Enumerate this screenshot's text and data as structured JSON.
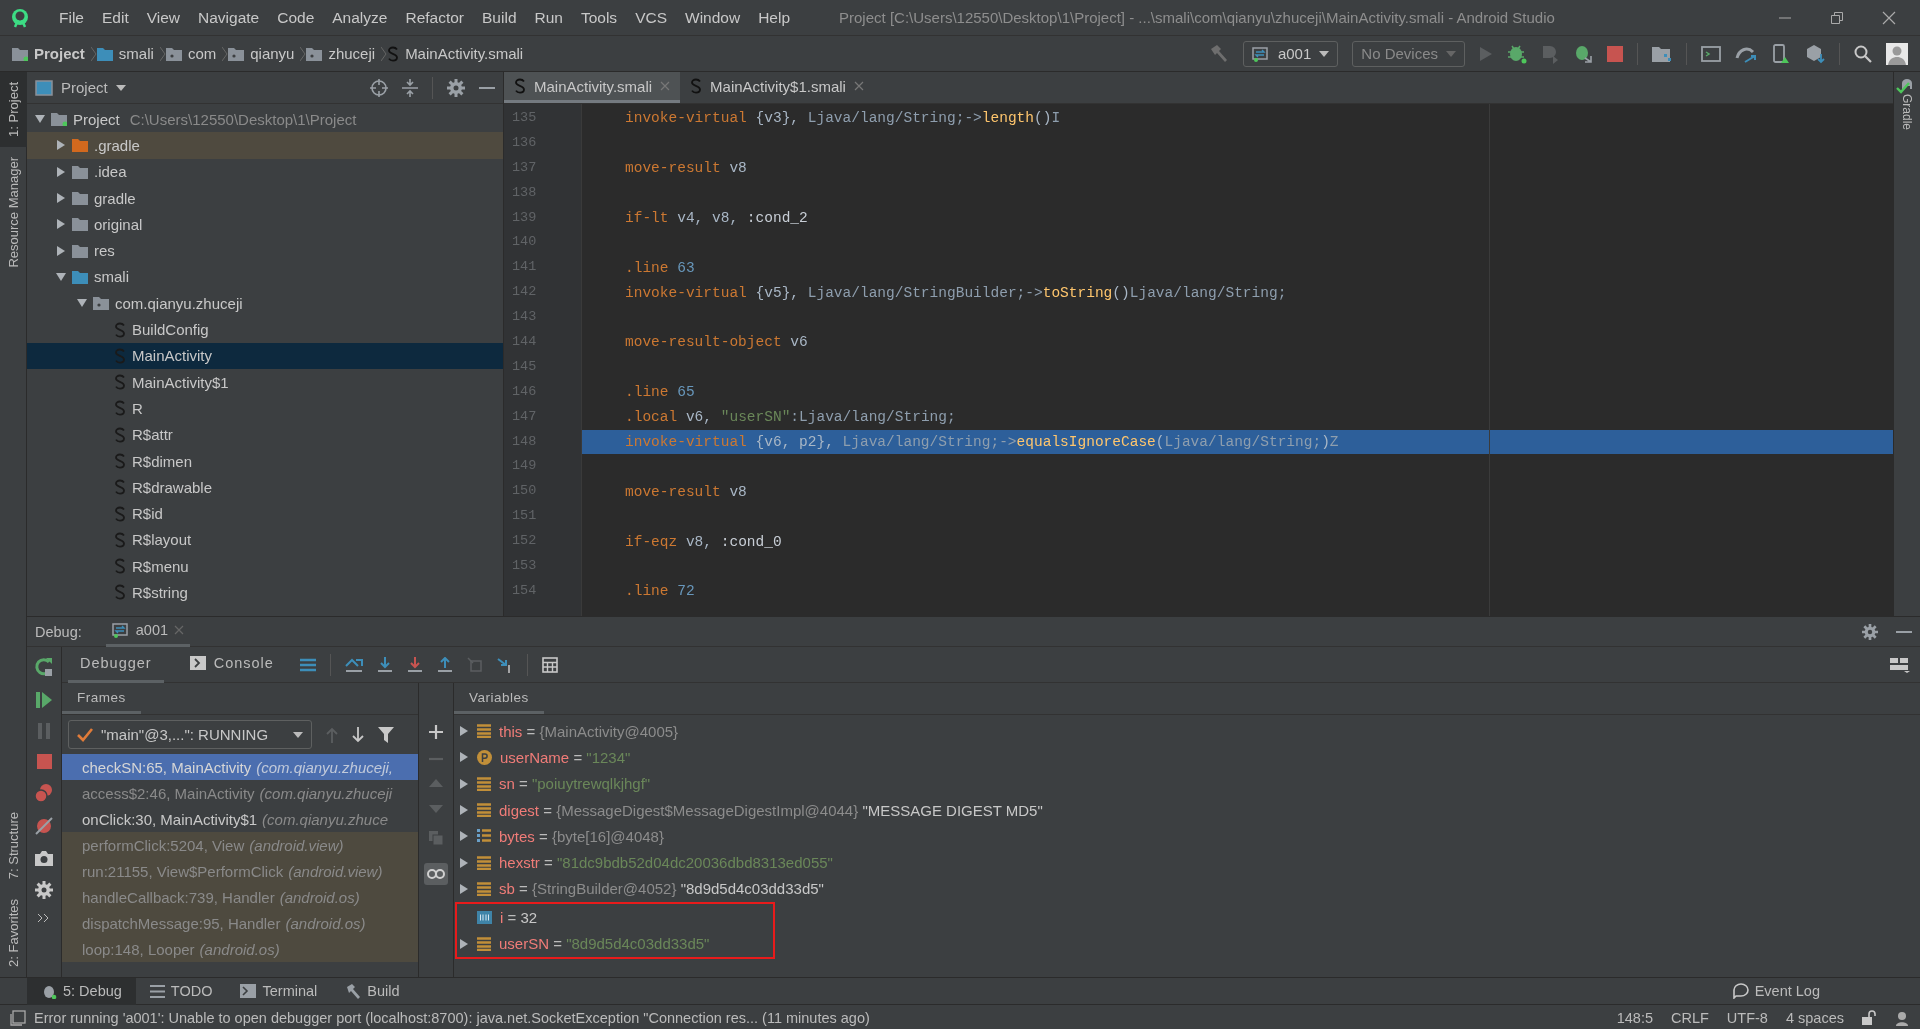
{
  "window": {
    "title": "Project [C:\\Users\\12550\\Desktop\\1\\Project] - ...\\smali\\com\\qianyu\\zhuceji\\MainActivity.smali - Android Studio"
  },
  "menu": [
    "File",
    "Edit",
    "View",
    "Navigate",
    "Code",
    "Analyze",
    "Refactor",
    "Build",
    "Run",
    "Tools",
    "VCS",
    "Window",
    "Help"
  ],
  "breadcrumb": [
    {
      "label": "Project",
      "kind": "project"
    },
    {
      "label": "smali",
      "kind": "source"
    },
    {
      "label": "com",
      "kind": "package"
    },
    {
      "label": "qianyu",
      "kind": "package"
    },
    {
      "label": "zhuceji",
      "kind": "package"
    },
    {
      "label": "MainActivity.smali",
      "kind": "file"
    }
  ],
  "toolbar": {
    "run_config": "a001",
    "device": "No Devices"
  },
  "left_strip": {
    "top": [
      {
        "label": "1: Project",
        "selected": true
      },
      {
        "label": "Resource Manager",
        "selected": false
      }
    ],
    "bottom": [
      {
        "label": "7: Structure",
        "selected": false
      },
      {
        "label": "2: Favorites",
        "selected": false
      }
    ]
  },
  "right_strip": [
    {
      "label": "Gradle"
    }
  ],
  "project_panel": {
    "title": "Project",
    "tree": [
      {
        "label": "Project",
        "path": "C:\\Users\\12550\\Desktop\\1\\Project",
        "kind": "project",
        "expanded": true,
        "selected": false,
        "children": [
          {
            "label": ".gradle",
            "kind": "excluded",
            "expanded": false,
            "selected": false
          },
          {
            "label": ".idea",
            "kind": "folder",
            "expanded": false,
            "selected": false
          },
          {
            "label": "gradle",
            "kind": "folder",
            "expanded": false,
            "selected": false
          },
          {
            "label": "original",
            "kind": "folder",
            "expanded": false,
            "selected": false
          },
          {
            "label": "res",
            "kind": "folder",
            "expanded": false,
            "selected": false
          },
          {
            "label": "smali",
            "kind": "source",
            "expanded": true,
            "selected": false,
            "children": [
              {
                "label": "com.qianyu.zhuceji",
                "kind": "package",
                "expanded": true,
                "selected": false,
                "children": [
                  {
                    "label": "BuildConfig",
                    "kind": "smali",
                    "selected": false
                  },
                  {
                    "label": "MainActivity",
                    "kind": "smali",
                    "selected": true
                  },
                  {
                    "label": "MainActivity$1",
                    "kind": "smali",
                    "selected": false
                  },
                  {
                    "label": "R",
                    "kind": "smali",
                    "selected": false
                  },
                  {
                    "label": "R$attr",
                    "kind": "smali",
                    "selected": false
                  },
                  {
                    "label": "R$dimen",
                    "kind": "smali",
                    "selected": false
                  },
                  {
                    "label": "R$drawable",
                    "kind": "smali",
                    "selected": false
                  },
                  {
                    "label": "R$id",
                    "kind": "smali",
                    "selected": false
                  },
                  {
                    "label": "R$layout",
                    "kind": "smali",
                    "selected": false
                  },
                  {
                    "label": "R$menu",
                    "kind": "smali",
                    "selected": false
                  },
                  {
                    "label": "R$string",
                    "kind": "smali",
                    "selected": false
                  }
                ]
              }
            ]
          }
        ]
      }
    ]
  },
  "editor": {
    "tabs": [
      {
        "label": "MainActivity.smali",
        "selected": true
      },
      {
        "label": "MainActivity$1.smali",
        "selected": false
      }
    ],
    "lines": [
      {
        "number": "135",
        "current": false,
        "tokens": [
          {
            "kind": "kw",
            "text": "invoke-virtual"
          },
          {
            "kind": "plain",
            "text": " {v3}, "
          },
          {
            "kind": "type",
            "text": "Ljava/lang/String;->"
          },
          {
            "kind": "method",
            "text": "length"
          },
          {
            "kind": "plain",
            "text": "()"
          },
          {
            "kind": "type",
            "text": "I"
          }
        ]
      },
      {
        "number": "136",
        "current": false
      },
      {
        "number": "137",
        "current": false,
        "tokens": [
          {
            "kind": "kw",
            "text": "move-result"
          },
          {
            "kind": "plain",
            "text": " v8"
          }
        ]
      },
      {
        "number": "138",
        "current": false
      },
      {
        "number": "139",
        "current": false,
        "tokens": [
          {
            "kind": "kw",
            "text": "if-lt"
          },
          {
            "kind": "plain",
            "text": " v4, v8, "
          },
          {
            "kind": "label",
            "text": ":cond_2"
          }
        ]
      },
      {
        "number": "140",
        "current": false
      },
      {
        "number": "141",
        "current": false,
        "tokens": [
          {
            "kind": "kw",
            "text": ".line"
          },
          {
            "kind": "num",
            "text": " 63"
          }
        ]
      },
      {
        "number": "142",
        "current": false,
        "tokens": [
          {
            "kind": "kw",
            "text": "invoke-virtual"
          },
          {
            "kind": "plain",
            "text": " {v5}, "
          },
          {
            "kind": "type",
            "text": "Ljava/lang/StringBuilder;->"
          },
          {
            "kind": "method",
            "text": "toString"
          },
          {
            "kind": "plain",
            "text": "()"
          },
          {
            "kind": "type",
            "text": "Ljava/lang/String;"
          }
        ]
      },
      {
        "number": "143",
        "current": false
      },
      {
        "number": "144",
        "current": false,
        "tokens": [
          {
            "kind": "kw",
            "text": "move-result-object"
          },
          {
            "kind": "plain",
            "text": " v6"
          }
        ]
      },
      {
        "number": "145",
        "current": false
      },
      {
        "number": "146",
        "current": false,
        "tokens": [
          {
            "kind": "kw",
            "text": ".line"
          },
          {
            "kind": "num",
            "text": " 65"
          }
        ]
      },
      {
        "number": "147",
        "current": false,
        "tokens": [
          {
            "kind": "kw",
            "text": ".local"
          },
          {
            "kind": "plain",
            "text": " v6, "
          },
          {
            "kind": "str",
            "text": "\"userSN\""
          },
          {
            "kind": "type",
            "text": ":Ljava/lang/String;"
          }
        ]
      },
      {
        "number": "148",
        "current": true,
        "tokens": [
          {
            "kind": "kw",
            "text": "invoke-virtual"
          },
          {
            "kind": "plain",
            "text": " {v6, p2}, "
          },
          {
            "kind": "type",
            "text": "Ljava/lang/String;->"
          },
          {
            "kind": "method",
            "text": "equalsIgnoreCase"
          },
          {
            "kind": "plain",
            "text": "("
          },
          {
            "kind": "type",
            "text": "Ljava/lang/String;"
          },
          {
            "kind": "plain",
            "text": ")"
          },
          {
            "kind": "type",
            "text": "Z"
          }
        ]
      },
      {
        "number": "149",
        "current": false
      },
      {
        "number": "150",
        "current": false,
        "tokens": [
          {
            "kind": "kw",
            "text": "move-result"
          },
          {
            "kind": "plain",
            "text": " v8"
          }
        ]
      },
      {
        "number": "151",
        "current": false
      },
      {
        "number": "152",
        "current": false,
        "tokens": [
          {
            "kind": "kw",
            "text": "if-eqz"
          },
          {
            "kind": "plain",
            "text": " v8, "
          },
          {
            "kind": "label",
            "text": ":cond_0"
          }
        ]
      },
      {
        "number": "153",
        "current": false
      },
      {
        "number": "154",
        "current": false,
        "tokens": [
          {
            "kind": "kw",
            "text": ".line"
          },
          {
            "kind": "num",
            "text": " 72"
          }
        ]
      }
    ]
  },
  "debug": {
    "title": "Debug:",
    "sessions": [
      {
        "label": "a001",
        "selected": true
      }
    ],
    "tabs": [
      {
        "label": "Debugger",
        "selected": true
      },
      {
        "label": "Console",
        "selected": false
      }
    ],
    "frames": {
      "tab": "Frames",
      "thread": "\"main\"@3,...\": RUNNING",
      "items": [
        {
          "method": "checkSN:65, MainActivity",
          "location": "(com.qianyu.zhuceji,",
          "kind": "app",
          "selected": true
        },
        {
          "method": "access$2:46, MainActivity",
          "location": "(com.qianyu.zhuceji",
          "kind": "synthetic",
          "selected": false
        },
        {
          "method": "onClick:30, MainActivity$1",
          "location": "(com.qianyu.zhuce",
          "kind": "app",
          "selected": false
        },
        {
          "method": "performClick:5204, View",
          "location": "(android.view)",
          "kind": "library",
          "selected": false
        },
        {
          "method": "run:21155, View$PerformClick",
          "location": "(android.view)",
          "kind": "library",
          "selected": false
        },
        {
          "method": "handleCallback:739, Handler",
          "location": "(android.os)",
          "kind": "library",
          "selected": false
        },
        {
          "method": "dispatchMessage:95, Handler",
          "location": "(android.os)",
          "kind": "library",
          "selected": false
        },
        {
          "method": "loop:148, Looper",
          "location": "(android.os)",
          "kind": "library",
          "selected": false
        }
      ]
    },
    "variables": {
      "tab": "Variables",
      "items": [
        {
          "name": "this",
          "sign": "=",
          "kind": "field",
          "expandable": true,
          "highlighted": false,
          "value": [
            {
              "kind": "ref",
              "text": "{MainActivity@4005}"
            }
          ]
        },
        {
          "name": "userName",
          "sign": "=",
          "kind": "param",
          "expandable": true,
          "highlighted": false,
          "value": [
            {
              "kind": "str",
              "text": "\"1234\""
            }
          ]
        },
        {
          "name": "sn",
          "sign": "=",
          "kind": "field",
          "expandable": true,
          "highlighted": false,
          "value": [
            {
              "kind": "str",
              "text": "\"poiuytrewqlkjhgf\""
            }
          ]
        },
        {
          "name": "digest",
          "sign": "=",
          "kind": "field",
          "expandable": true,
          "highlighted": false,
          "value": [
            {
              "kind": "ref",
              "text": "{MessageDigest$MessageDigestImpl@4044}"
            },
            {
              "kind": "plain",
              "text": "\"MESSAGE DIGEST MD5\""
            }
          ]
        },
        {
          "name": "bytes",
          "sign": "=",
          "kind": "array",
          "expandable": true,
          "highlighted": false,
          "value": [
            {
              "kind": "ref",
              "text": "{byte[16]@4048}"
            }
          ]
        },
        {
          "name": "hexstr",
          "sign": "=",
          "kind": "field",
          "expandable": true,
          "highlighted": false,
          "value": [
            {
              "kind": "str",
              "text": "\"81dc9bdb52d04dc20036dbd8313ed055\""
            }
          ]
        },
        {
          "name": "sb",
          "sign": "=",
          "kind": "field",
          "expandable": true,
          "highlighted": false,
          "value": [
            {
              "kind": "ref",
              "text": "{StringBuilder@4052}"
            },
            {
              "kind": "plain",
              "text": "\"8d9d5d4c03dd33d5\""
            }
          ]
        },
        {
          "name": "i",
          "sign": "=",
          "kind": "primitive",
          "expandable": false,
          "highlighted": true,
          "value": [
            {
              "kind": "plain",
              "text": "32"
            }
          ]
        },
        {
          "name": "userSN",
          "sign": "=",
          "kind": "field",
          "expandable": true,
          "highlighted": true,
          "value": [
            {
              "kind": "str",
              "text": "\"8d9d5d4c03dd33d5\""
            }
          ]
        }
      ]
    }
  },
  "tool_windows": [
    {
      "label": "5: Debug",
      "kind": "debug",
      "selected": true
    },
    {
      "label": "TODO",
      "kind": "todo",
      "selected": false
    },
    {
      "label": "Terminal",
      "kind": "terminal",
      "selected": false
    },
    {
      "label": "Build",
      "kind": "build",
      "selected": false
    }
  ],
  "event_log": "Event Log",
  "status_bar": {
    "message": "Error running 'a001': Unable to open debugger port (localhost:8700): java.net.SocketException \"Connection res... (11 minutes ago)",
    "position": "148:5",
    "line_separator": "CRLF",
    "encoding": "UTF-8",
    "indent": "4 spaces"
  }
}
